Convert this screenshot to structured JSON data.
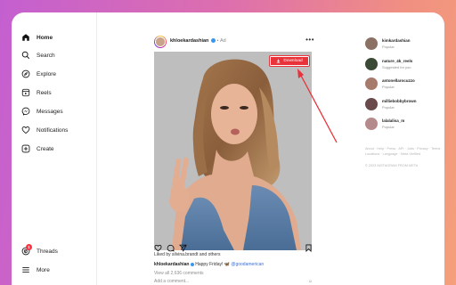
{
  "sidebar": {
    "items": [
      {
        "label": "Home",
        "icon": "home-icon",
        "active": true
      },
      {
        "label": "Search",
        "icon": "search-icon"
      },
      {
        "label": "Explore",
        "icon": "compass-icon"
      },
      {
        "label": "Reels",
        "icon": "reels-icon"
      },
      {
        "label": "Messages",
        "icon": "messenger-icon"
      },
      {
        "label": "Notifications",
        "icon": "heart-icon"
      },
      {
        "label": "Create",
        "icon": "plus-square-icon"
      }
    ],
    "threads": {
      "label": "Threads",
      "badge": "1"
    },
    "more": {
      "label": "More"
    }
  },
  "post": {
    "username": "khloekardashian",
    "separator": "•",
    "tag": "Ad",
    "download_label": "Download",
    "likes_text": "Liked by silvina.brandt and others",
    "caption_user": "khloekardashian",
    "caption_text": "Happy Friday! 🦋 ",
    "caption_mention": "@goodamerican",
    "comments_text": "View all 2,636 comments",
    "add_comment_placeholder": "Add a comment..."
  },
  "suggestions": [
    {
      "name": "kimkardashian",
      "sub": "Popular",
      "color": "#8a7163"
    },
    {
      "name": "nature_4k_reels",
      "sub": "Suggested for you",
      "color": "#3b4a35"
    },
    {
      "name": "antonellarocuzzo",
      "sub": "Popular",
      "color": "#a77b6b"
    },
    {
      "name": "milliebobbybrown",
      "sub": "Popular",
      "color": "#6a4a4a"
    },
    {
      "name": "lalalalisa_m",
      "sub": "Popular",
      "color": "#b58a8a"
    }
  ],
  "footer": {
    "links": "About · Help · Press · API · Jobs · Privacy · Terms · Locations · Language · Meta Verified",
    "copyright": "© 2023 INSTAGRAM FROM META"
  },
  "colors": {
    "accent": "#e8333a",
    "link": "#3a6fd8"
  }
}
